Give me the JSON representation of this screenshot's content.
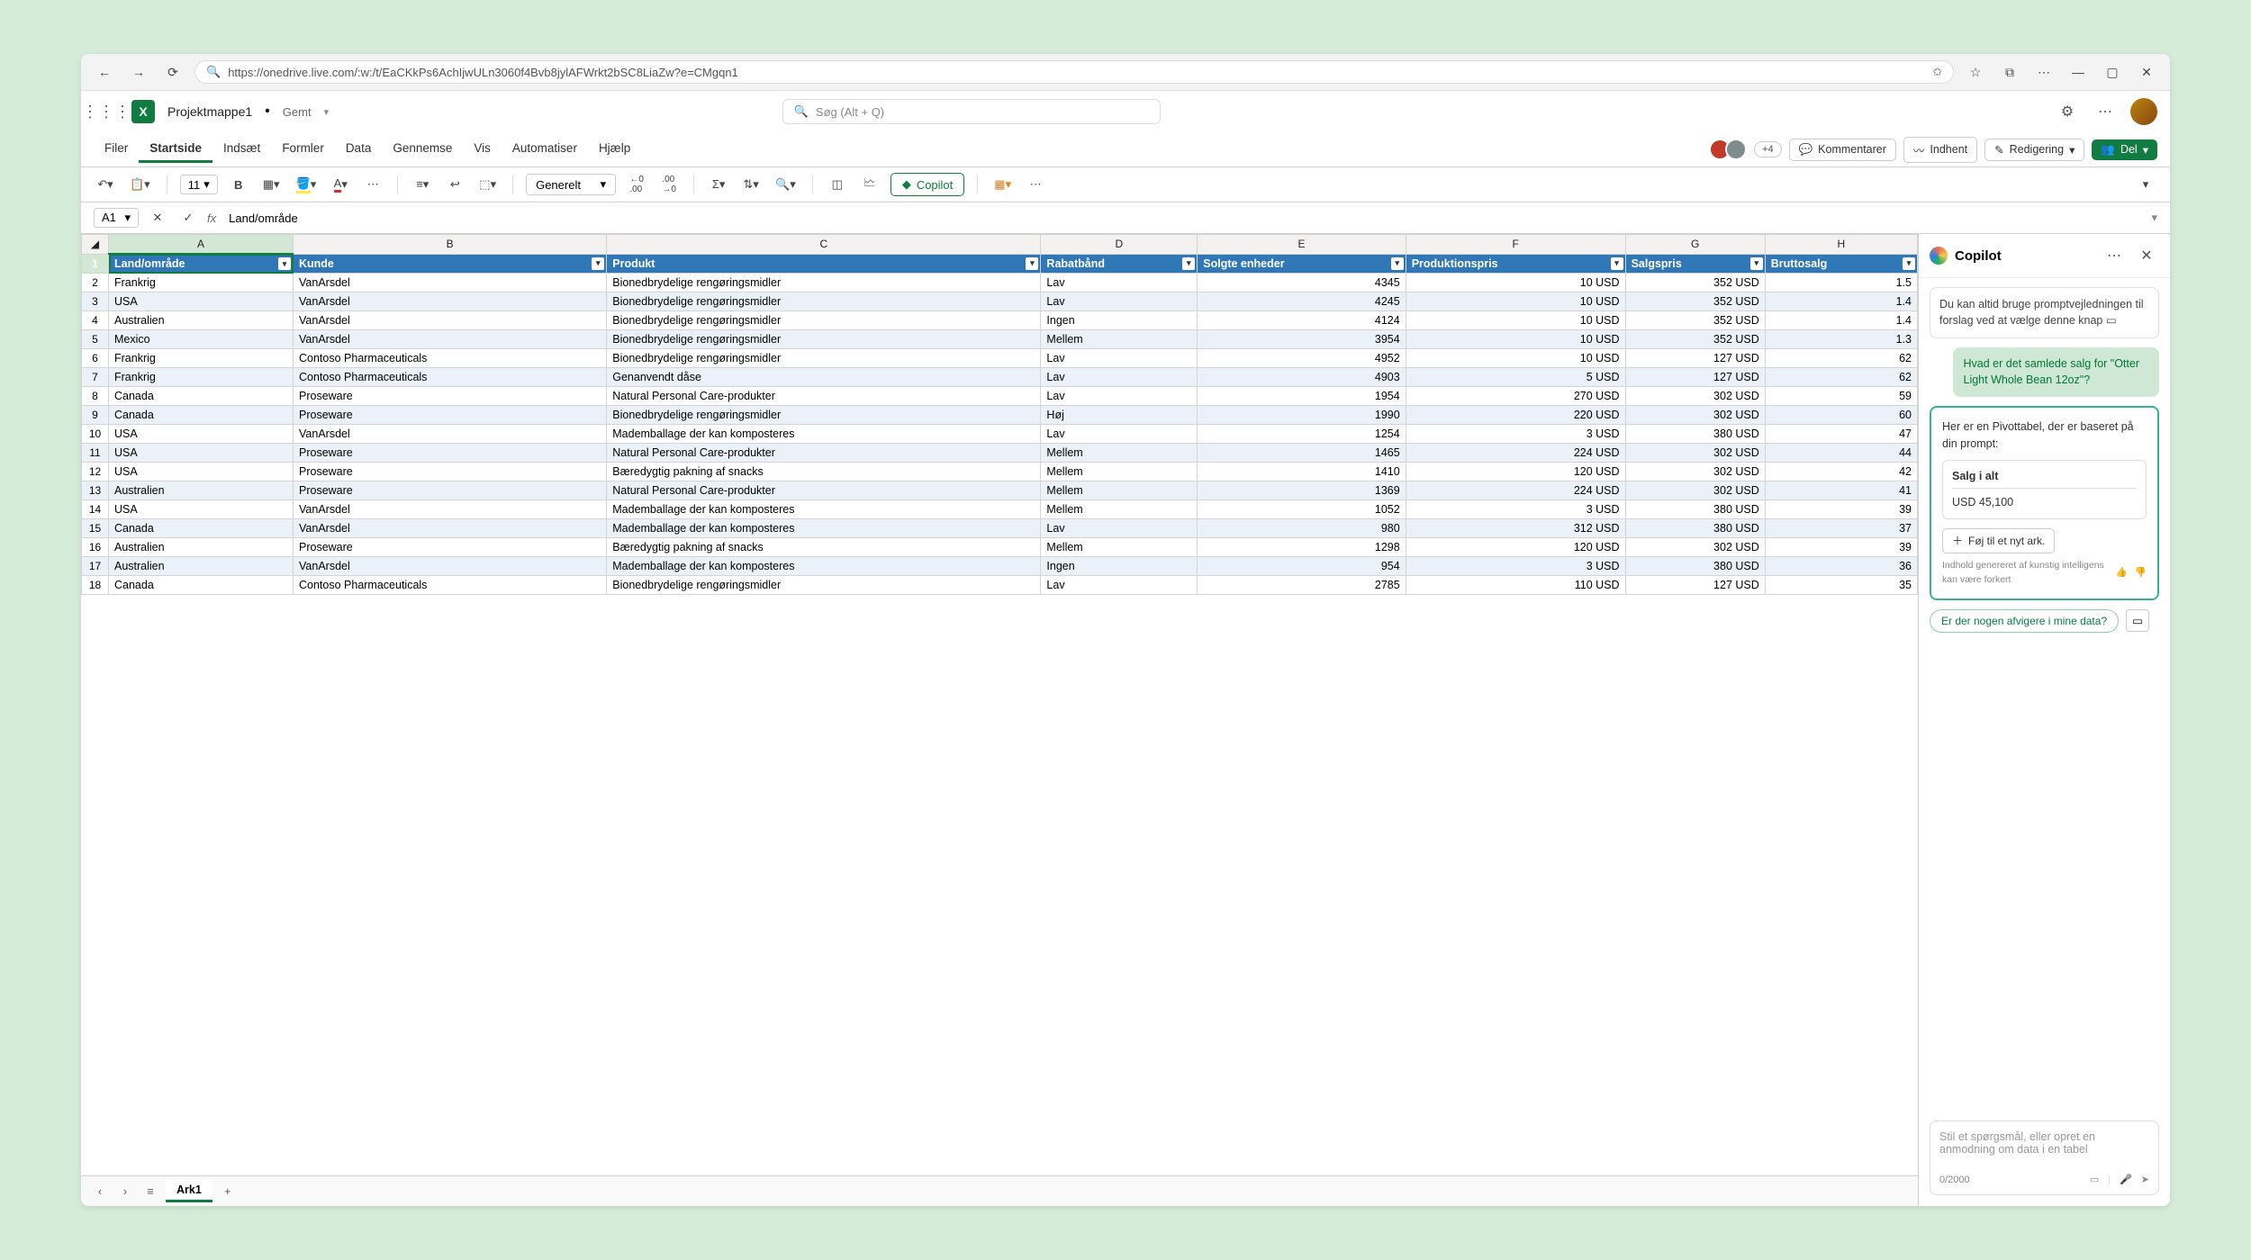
{
  "browser": {
    "url": "https://onedrive.live.com/:w:/t/EaCKkPs6AchIjwULn3060f4Bvb8jylAFWrkt2bSC8LiaZw?e=CMgqn1"
  },
  "app": {
    "doc_name": "Projektmappe1",
    "status_saved": "Gemt",
    "search_placeholder": "Søg (Alt + Q)"
  },
  "ribbon": {
    "tabs": [
      "Filer",
      "Startside",
      "Indsæt",
      "Formler",
      "Data",
      "Gennemse",
      "Vis",
      "Automatiser",
      "Hjælp"
    ],
    "active_index": 1,
    "presence_more": "+4",
    "comments": "Kommentarer",
    "catchup": "Indhent",
    "editing": "Redigering",
    "share": "Del"
  },
  "toolbar": {
    "font_size": "11",
    "number_format": "Generelt",
    "copilot": "Copilot"
  },
  "formula_bar": {
    "cell_ref": "A1",
    "value": "Land/område"
  },
  "grid": {
    "columns": [
      "A",
      "B",
      "C",
      "D",
      "E",
      "F",
      "G",
      "H"
    ],
    "headers": [
      "Land/område",
      "Kunde",
      "Produkt",
      "Rabatbånd",
      "Solgte enheder",
      "Produktionspris",
      "Salgspris",
      "Bruttosalg"
    ],
    "rows": [
      [
        "Frankrig",
        "VanArsdel",
        "Bionedbrydelige rengøringsmidler",
        "Lav",
        "4345",
        "10 USD",
        "352 USD",
        "1.5"
      ],
      [
        "USA",
        "VanArsdel",
        "Bionedbrydelige rengøringsmidler",
        "Lav",
        "4245",
        "10 USD",
        "352 USD",
        "1.4"
      ],
      [
        "Australien",
        "VanArsdel",
        "Bionedbrydelige rengøringsmidler",
        "Ingen",
        "4124",
        "10 USD",
        "352 USD",
        "1.4"
      ],
      [
        "Mexico",
        "VanArsdel",
        "Bionedbrydelige rengøringsmidler",
        "Mellem",
        "3954",
        "10 USD",
        "352 USD",
        "1.3"
      ],
      [
        "Frankrig",
        "Contoso Pharmaceuticals",
        "Bionedbrydelige rengøringsmidler",
        "Lav",
        "4952",
        "10 USD",
        "127 USD",
        "62"
      ],
      [
        "Frankrig",
        "Contoso Pharmaceuticals",
        "Genanvendt dåse",
        "Lav",
        "4903",
        "5 USD",
        "127 USD",
        "62"
      ],
      [
        "Canada",
        "Proseware",
        "Natural Personal Care-produkter",
        "Lav",
        "1954",
        "270 USD",
        "302 USD",
        "59"
      ],
      [
        "Canada",
        "Proseware",
        "Bionedbrydelige rengøringsmidler",
        "Høj",
        "1990",
        "220 USD",
        "302 USD",
        "60"
      ],
      [
        "USA",
        "VanArsdel",
        "Mademballage der kan komposteres",
        "Lav",
        "1254",
        "3 USD",
        "380 USD",
        "47"
      ],
      [
        "USA",
        "Proseware",
        "Natural Personal Care-produkter",
        "Mellem",
        "1465",
        "224 USD",
        "302 USD",
        "44"
      ],
      [
        "USA",
        "Proseware",
        "Bæredygtig pakning af snacks",
        "Mellem",
        "1410",
        "120 USD",
        "302 USD",
        "42"
      ],
      [
        "Australien",
        "Proseware",
        "Natural Personal Care-produkter",
        "Mellem",
        "1369",
        "224 USD",
        "302 USD",
        "41"
      ],
      [
        "USA",
        "VanArsdel",
        "Mademballage der kan komposteres",
        "Mellem",
        "1052",
        "3 USD",
        "380 USD",
        "39"
      ],
      [
        "Canada",
        "VanArsdel",
        "Mademballage der kan komposteres",
        "Lav",
        "980",
        "312 USD",
        "380 USD",
        "37"
      ],
      [
        "Australien",
        "Proseware",
        "Bæredygtig pakning af snacks",
        "Mellem",
        "1298",
        "120 USD",
        "302 USD",
        "39"
      ],
      [
        "Australien",
        "VanArsdel",
        "Mademballage der kan komposteres",
        "Ingen",
        "954",
        "3 USD",
        "380 USD",
        "36"
      ],
      [
        "Canada",
        "Contoso Pharmaceuticals",
        "Bionedbrydelige rengøringsmidler",
        "Lav",
        "2785",
        "110 USD",
        "127 USD",
        "35"
      ]
    ]
  },
  "sheet": {
    "name": "Ark1"
  },
  "copilot": {
    "title": "Copilot",
    "hint": "Du kan altid bruge promptvejledningen til forslag ved at vælge denne knap",
    "user_msg": "Hvad er det samlede salg for \"Otter Light Whole Bean 12oz\"?",
    "reply_intro": "Her er en Pivottabel, der er baseret på din prompt:",
    "pivot_label": "Salg i alt",
    "pivot_value": "USD 45,100",
    "add_to_sheet": "Føj til et nyt ark.",
    "disclaimer": "Indhold genereret af kunstig intelligens kan være forkert",
    "chip": "Er der nogen afvigere i mine data?",
    "input_placeholder": "Stil et spørgsmål, eller opret en anmodning om data i en tabel",
    "char_count": "0/2000"
  }
}
